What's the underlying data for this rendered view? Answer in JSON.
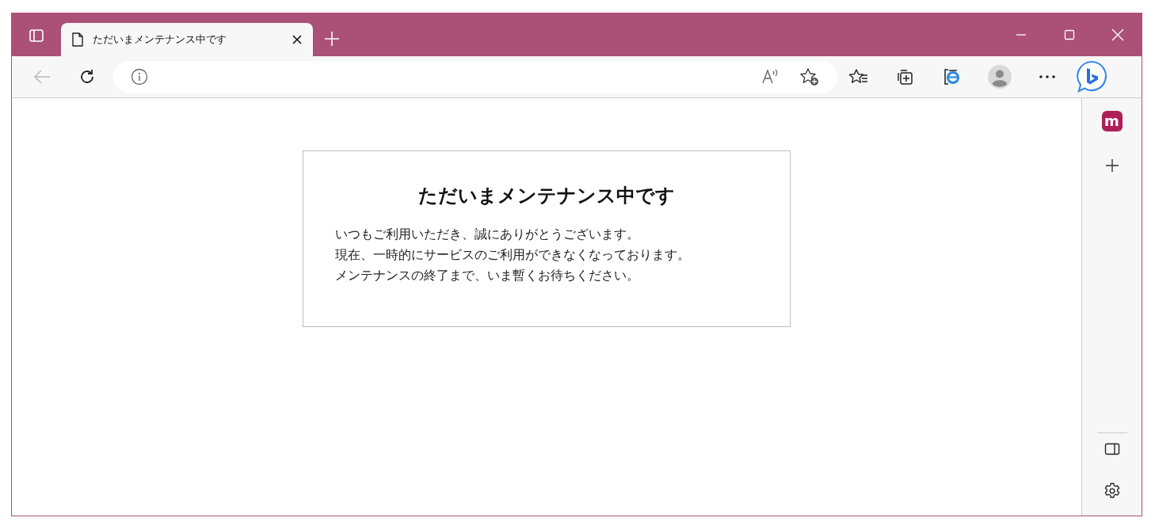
{
  "tabs": [
    {
      "title": "ただいまメンテナンス中です",
      "selected": true
    }
  ],
  "sidebar": {
    "app_label": "m"
  },
  "page": {
    "heading": "ただいまメンテナンス中です",
    "message_lines": [
      "いつもご利用いただき、誠にありがとうございます。",
      "現在、一時的にサービスのご利用ができなくなっております。",
      "メンテナンスの終了まで、いま暫くお待ちください。"
    ]
  }
}
